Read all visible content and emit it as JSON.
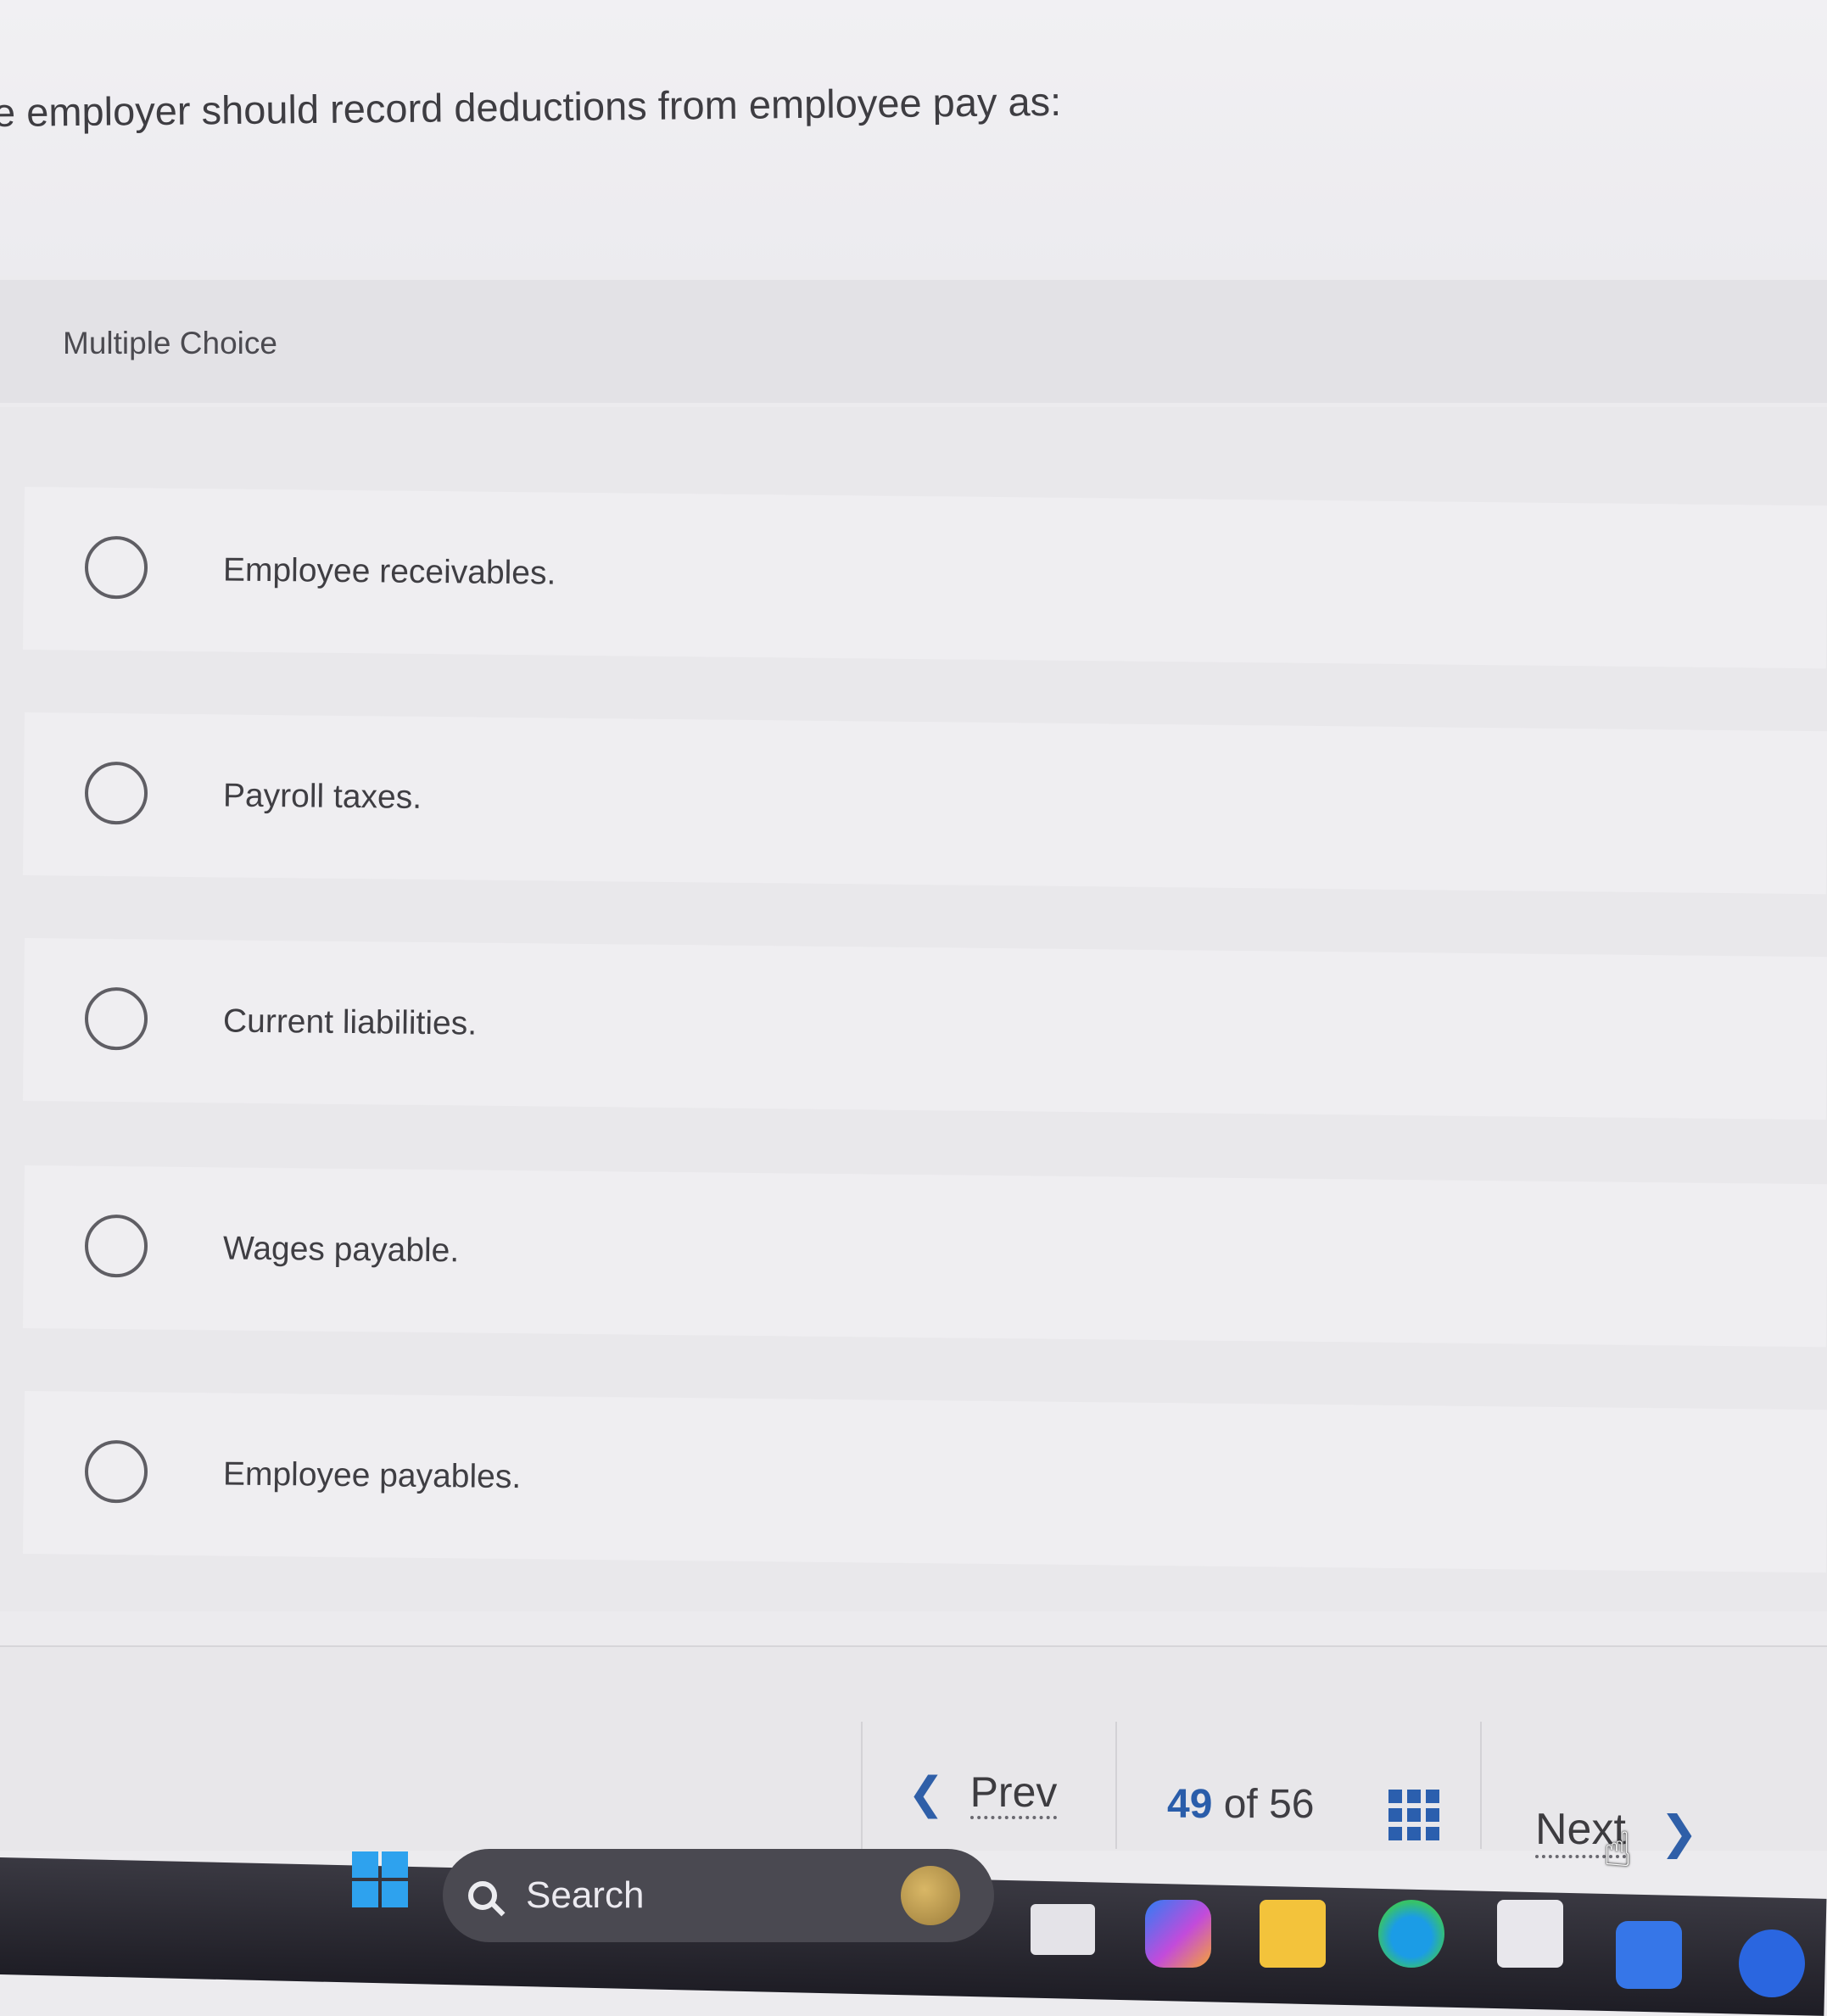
{
  "question": {
    "text": "e employer should record deductions from employee pay as:"
  },
  "section": {
    "label": "Multiple Choice"
  },
  "choices": [
    {
      "label": "Employee receivables.",
      "selected": false
    },
    {
      "label": "Payroll taxes.",
      "selected": false
    },
    {
      "label": "Current liabilities.",
      "selected": false
    },
    {
      "label": "Wages payable.",
      "selected": false
    },
    {
      "label": "Employee payables.",
      "selected": false
    }
  ],
  "navigation": {
    "prev_label": "Prev",
    "next_label": "Next",
    "current_page": "49",
    "of_label": "of",
    "total_pages": "56",
    "prev_icon": "chevron-left-icon",
    "next_icon": "chevron-right-icon",
    "grid_icon": "question-grid-icon"
  },
  "taskbar": {
    "search_label": "Search",
    "icons": [
      "windows-start-icon",
      "search-icon",
      "task-view-icon",
      "copilot-icon",
      "file-explorer-icon",
      "edge-icon",
      "microsoft-store-icon"
    ]
  },
  "colors": {
    "accent": "#2b5fae",
    "page_background": "#ecebee",
    "taskbar": "#26252d"
  }
}
